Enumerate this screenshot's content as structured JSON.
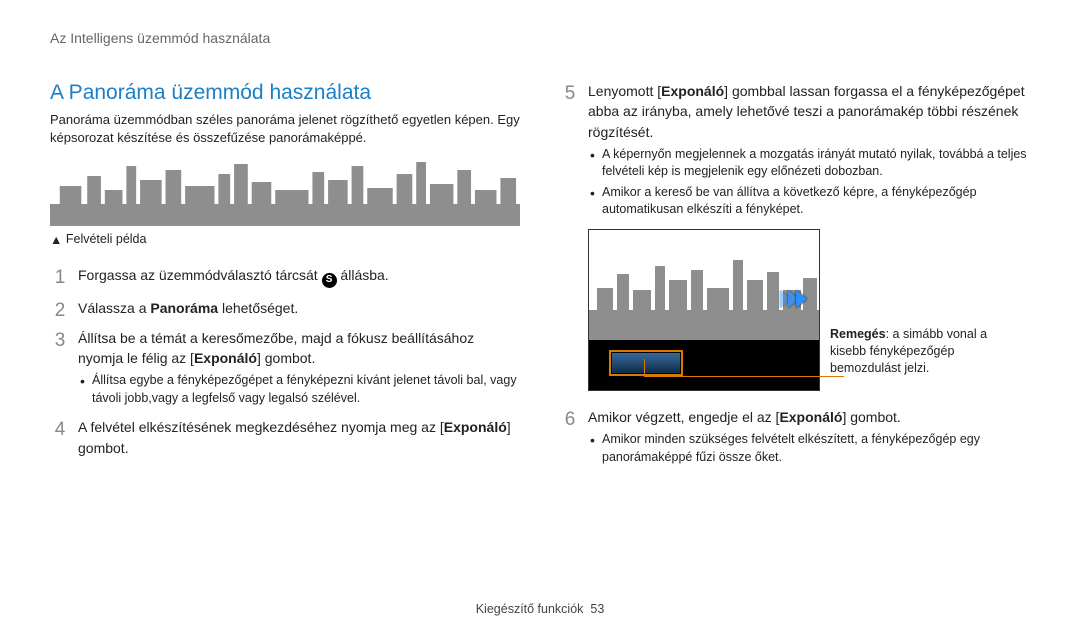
{
  "header": "Az Intelligens üzemmód használata",
  "left": {
    "title": "A Panoráma üzemmód használata",
    "intro": "Panoráma üzemmódban széles panoráma jelenet rögzíthető egyetlen képen. Egy képsorozat készítése és összefűzése panorámaképpé.",
    "caption": "Felvételi példa",
    "steps": [
      {
        "pre": "Forgassa az üzemmódválasztó tárcsát ",
        "icon": "S",
        "post": " állásba."
      },
      {
        "html": "Válassza a <b>Panoráma</b> lehetőséget."
      },
      {
        "html": "Állítsa be a témát a keresőmezőbe, majd a fókusz beállításához nyomja le félig az [<b>Exponáló</b>] gombot.",
        "sub": [
          "Állítsa egybe a fényképezőgépet a fényképezni kívánt jelenet távoli bal, vagy távoli jobb,vagy a legfelső vagy legalsó szélével."
        ]
      },
      {
        "html": "A felvétel elkészítésének megkezdéséhez nyomja meg az [<b>Exponáló</b>] gombot."
      }
    ]
  },
  "right": {
    "steps": [
      {
        "html": "Lenyomott [<b>Exponáló</b>] gombbal lassan forgassa el a fényképezőgépet abba az irányba, amely lehetővé teszi a panorámakép többi részének rögzítését.",
        "sub": [
          "A képernyőn megjelennek a mozgatás irányát mutató nyilak, továbbá a teljes felvételi kép is megjelenik egy előnézeti dobozban.",
          "Amikor a kereső be van állítva a következő képre, a fényképezőgép automatikusan elkészíti a fényképet."
        ]
      },
      {
        "html": "Amikor végzett, engedje el az [<b>Exponáló</b>] gombot.",
        "sub": [
          "Amikor minden szükséges felvételt elkészített, a fényképezőgép egy panorámaképpé fűzi össze őket."
        ]
      }
    ],
    "callout": "<b>Remegés</b>: a simább vonal a kisebb fényképezőgép bemozdulást jelzi."
  },
  "footer": {
    "label": "Kiegészítő funkciók",
    "page": "53"
  }
}
